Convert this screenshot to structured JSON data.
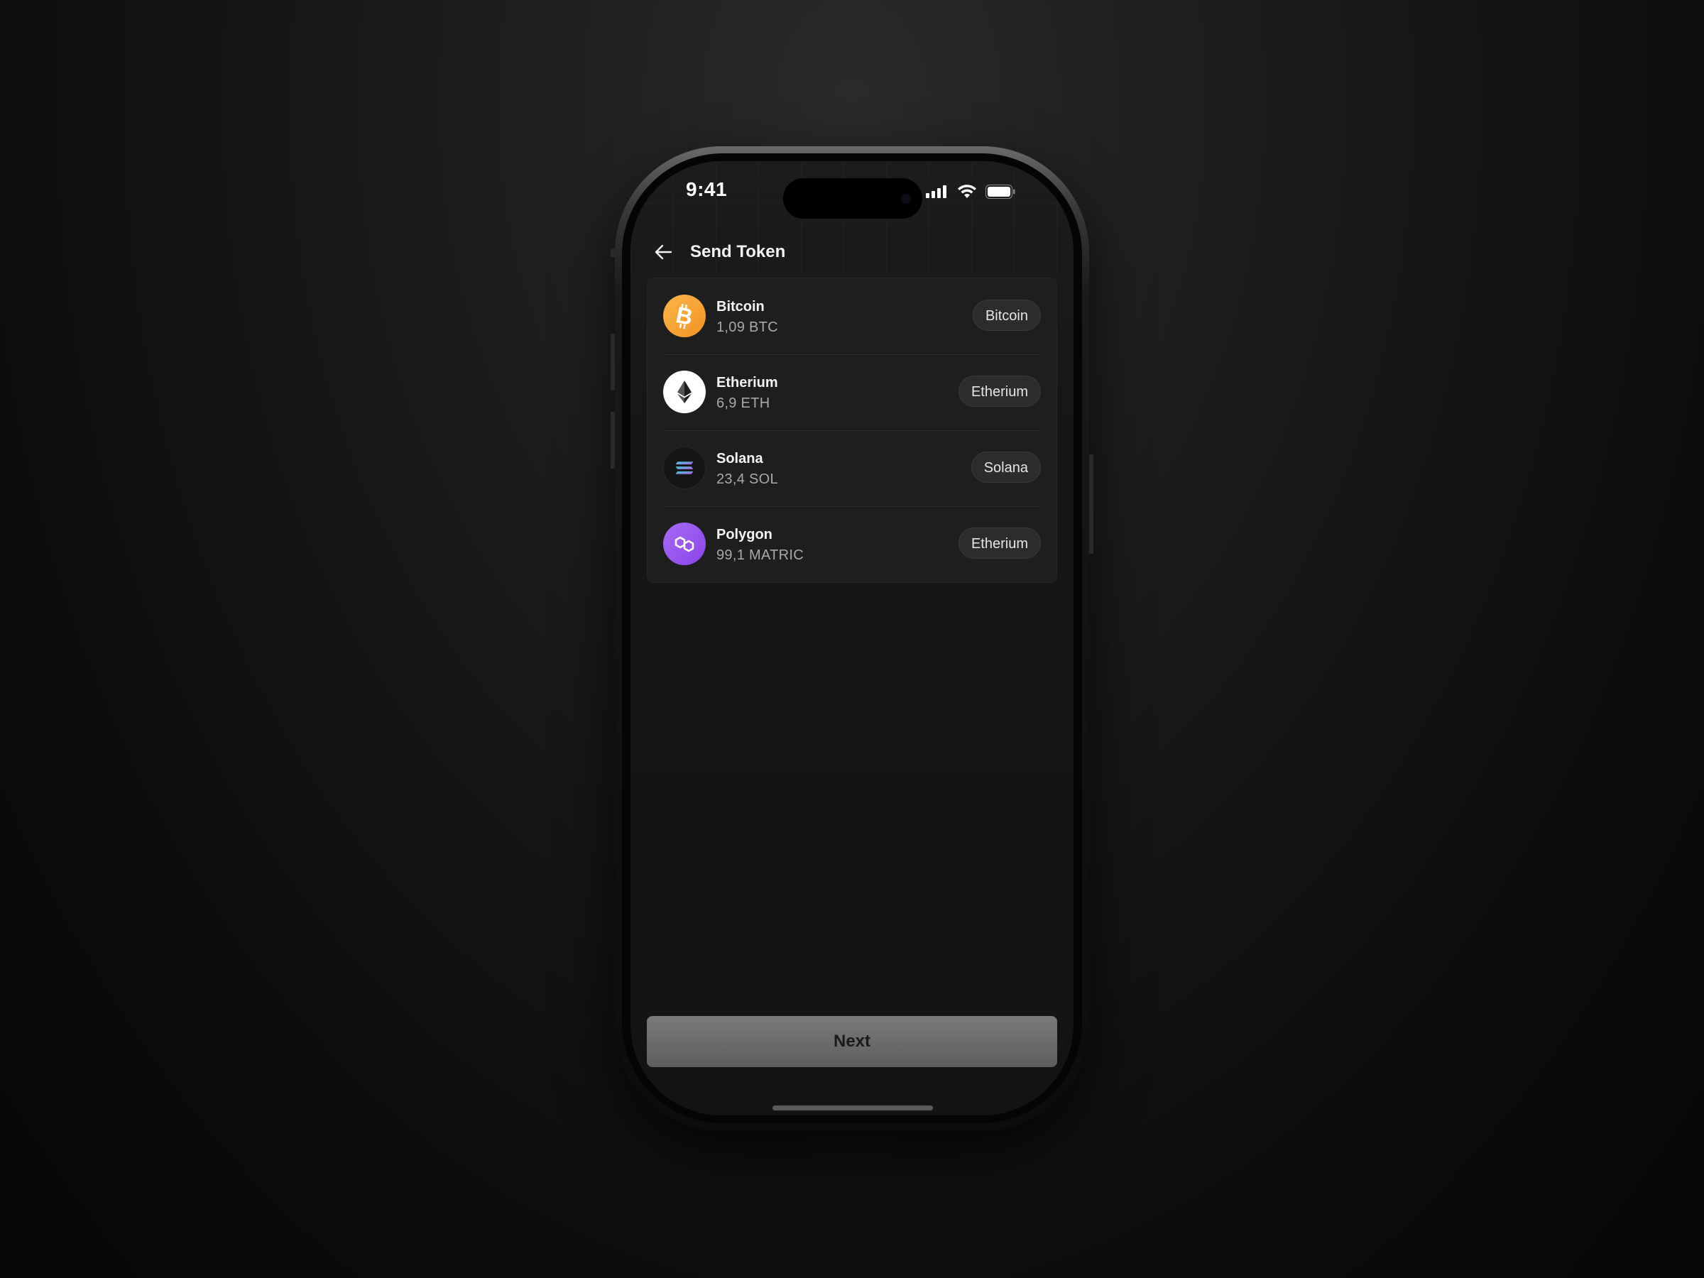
{
  "status_bar": {
    "time": "9:41",
    "icons": [
      "signal-icon",
      "wifi-icon",
      "battery-icon"
    ]
  },
  "header": {
    "back_icon": "arrow-left-icon",
    "title": "Send Token"
  },
  "tokens": [
    {
      "name": "Bitcoin",
      "amount": "1,09 BTC",
      "network": "Bitcoin",
      "icon": "bitcoin-icon",
      "color": "#F7A23B"
    },
    {
      "name": "Etherium",
      "amount": "6,9 ETH",
      "network": "Etherium",
      "icon": "ethereum-icon",
      "color": "#FFFFFF"
    },
    {
      "name": "Solana",
      "amount": "23,4 SOL",
      "network": "Solana",
      "icon": "solana-icon",
      "color": "#151515"
    },
    {
      "name": "Polygon",
      "amount": "99,1 MATRIC",
      "network": "Etherium",
      "icon": "polygon-icon",
      "color": "#9B5CF0"
    }
  ],
  "footer": {
    "next_label": "Next"
  }
}
